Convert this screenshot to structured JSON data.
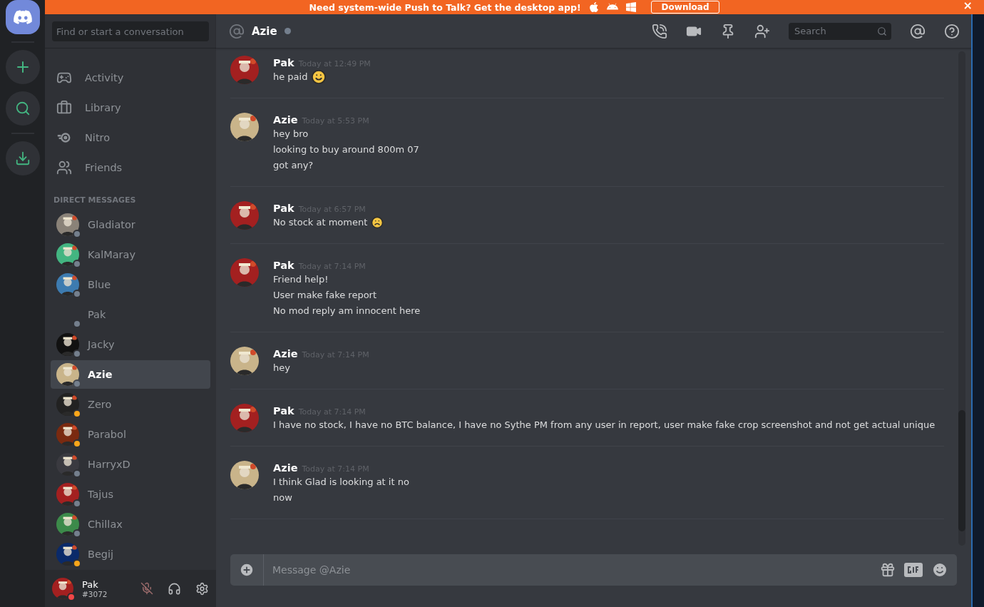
{
  "banner": {
    "text": "Need system-wide Push to Talk? Get the desktop app!",
    "button": "Download",
    "close": "×"
  },
  "sidebar": {
    "search": {
      "placeholder": "Find or start a conversation"
    },
    "nav": [
      {
        "label": "Activity",
        "kind": "activity"
      },
      {
        "label": "Library",
        "kind": "library"
      },
      {
        "label": "Nitro",
        "kind": "nitro"
      },
      {
        "label": "Friends",
        "kind": "friends"
      }
    ],
    "dm_heading": "DIRECT MESSAGES",
    "dms": [
      {
        "name": "Gladiator",
        "selected": false,
        "has_avatar": true,
        "color": "#747f8d"
      },
      {
        "name": "KalMaray",
        "selected": false,
        "has_avatar": true,
        "color": "#747f8d"
      },
      {
        "name": "Blue",
        "selected": false,
        "has_avatar": true,
        "color": "#747f8d"
      },
      {
        "name": "Pak",
        "selected": false,
        "has_avatar": false,
        "color": "#747f8d"
      },
      {
        "name": "Jacky",
        "selected": false,
        "has_avatar": true,
        "color": "#747f8d"
      },
      {
        "name": "Azie",
        "selected": true,
        "has_avatar": true,
        "color": "#747f8d"
      },
      {
        "name": "Zero",
        "selected": false,
        "has_avatar": true,
        "color": "#faa61a"
      },
      {
        "name": "Parabol",
        "selected": false,
        "has_avatar": true,
        "color": "#faa61a"
      },
      {
        "name": "HarryxD",
        "selected": false,
        "has_avatar": true,
        "color": "#747f8d"
      },
      {
        "name": "Tajus",
        "selected": false,
        "has_avatar": true,
        "color": "#747f8d"
      },
      {
        "name": "Chillax",
        "selected": false,
        "has_avatar": true,
        "color": "#747f8d"
      },
      {
        "name": "Begij",
        "selected": false,
        "has_avatar": true,
        "color": "#faa61a"
      }
    ],
    "user": {
      "name": "Pak",
      "tag": "#3072",
      "color": "#f04747",
      "muted": true
    }
  },
  "header": {
    "channel": "Azie",
    "search": {
      "placeholder": "Search"
    }
  },
  "messages": [
    {
      "author": "Pak",
      "time": "Today at 12:49 PM",
      "lines": [
        {
          "text": "he paid",
          "kind": "smile"
        }
      ]
    },
    {
      "author": "Azie",
      "time": "Today at 5:53 PM",
      "lines": [
        {
          "text": "hey bro",
          "kind": "plain"
        },
        {
          "text": "looking to buy around 800m 07",
          "kind": "plain"
        },
        {
          "text": "got any?",
          "kind": "plain"
        }
      ]
    },
    {
      "author": "Pak",
      "time": "Today at 6:57 PM",
      "lines": [
        {
          "text": "No stock at moment",
          "kind": "frown"
        }
      ]
    },
    {
      "author": "Pak",
      "time": "Today at 7:14 PM",
      "lines": [
        {
          "text": "Friend help!",
          "kind": "plain"
        },
        {
          "text": "User make fake report",
          "kind": "plain"
        },
        {
          "text": "No mod reply am innocent here",
          "kind": "plain"
        }
      ]
    },
    {
      "author": "Azie",
      "time": "Today at 7:14 PM",
      "lines": [
        {
          "text": "hey",
          "kind": "plain"
        }
      ]
    },
    {
      "author": "Pak",
      "time": "Today at 7:14 PM",
      "lines": [
        {
          "text": "I have no stock, I have no BTC balance, I have no Sythe PM from any user in report, user make fake crop screenshot and not get actual unique",
          "kind": "plain"
        }
      ]
    },
    {
      "author": "Azie",
      "time": "Today at 7:14 PM",
      "lines": [
        {
          "text": "I think Glad is looking at it no",
          "kind": "plain"
        },
        {
          "text": "now",
          "kind": "plain"
        }
      ]
    }
  ],
  "composer": {
    "placeholder": "Message @Azie"
  }
}
